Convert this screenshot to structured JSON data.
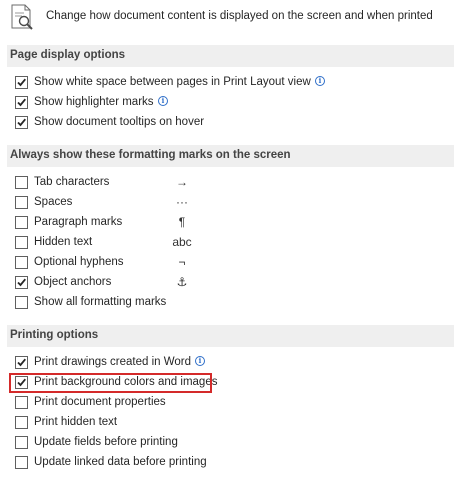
{
  "header": {
    "icon": "document-magnifier-icon",
    "description": "Change how document content is displayed on the screen and when printed"
  },
  "sections": {
    "page_display": {
      "title": "Page display options"
    },
    "formatting_marks": {
      "title": "Always show these formatting marks on the screen"
    },
    "printing": {
      "title": "Printing options"
    }
  },
  "page_display_options": [
    {
      "label": "Show white space between pages in Print Layout view",
      "checked": true,
      "info": true
    },
    {
      "label": "Show highlighter marks",
      "checked": true,
      "info": true
    },
    {
      "label": "Show document tooltips on hover",
      "checked": true,
      "info": false
    }
  ],
  "formatting_marks": [
    {
      "label": "Tab characters",
      "checked": false,
      "symbol": "→"
    },
    {
      "label": "Spaces",
      "checked": false,
      "symbol": "···"
    },
    {
      "label": "Paragraph marks",
      "checked": false,
      "symbol": "¶"
    },
    {
      "label": "Hidden text",
      "checked": false,
      "symbol": "abc"
    },
    {
      "label": "Optional hyphens",
      "checked": false,
      "symbol": "¬"
    },
    {
      "label": "Object anchors",
      "checked": true,
      "symbol": "⚓"
    },
    {
      "label": "Show all formatting marks",
      "checked": false,
      "symbol": ""
    }
  ],
  "printing_options": [
    {
      "label": "Print drawings created in Word",
      "checked": true,
      "info": true
    },
    {
      "label": "Print background colors and images",
      "checked": true,
      "info": false,
      "highlighted": true
    },
    {
      "label": "Print document properties",
      "checked": false,
      "info": false
    },
    {
      "label": "Print hidden text",
      "checked": false,
      "info": false
    },
    {
      "label": "Update fields before printing",
      "checked": false,
      "info": false
    },
    {
      "label": "Update linked data before printing",
      "checked": false,
      "info": false
    }
  ],
  "colors": {
    "highlight_border": "#d42a2a",
    "section_background": "#efefef",
    "info_icon": "#2f6fc9"
  }
}
